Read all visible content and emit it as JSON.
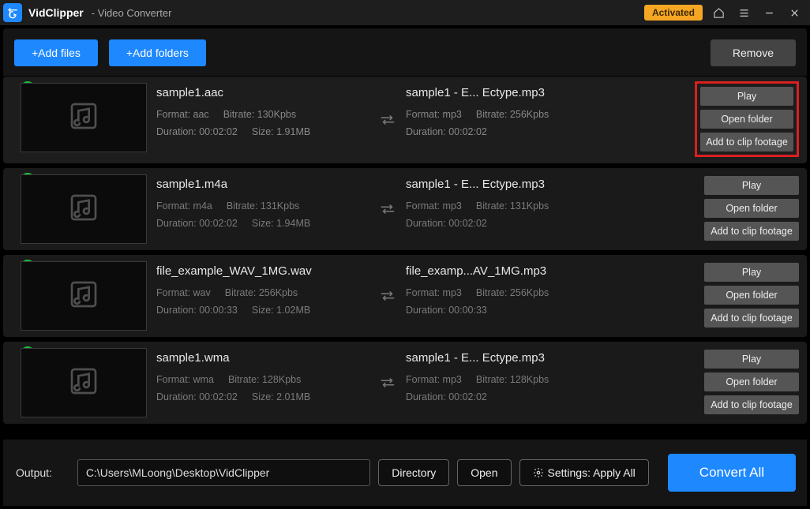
{
  "titlebar": {
    "app_name": "VidClipper",
    "subtitle": "- Video Converter",
    "activated": "Activated"
  },
  "toolbar": {
    "add_files": "+Add files",
    "add_folders": "+Add folders",
    "remove": "Remove"
  },
  "items": [
    {
      "highlight": true,
      "boxed": true,
      "src": {
        "name": "sample1.aac",
        "format": "Format: aac",
        "bitrate": "Bitrate: 130Kpbs",
        "duration": "Duration: 00:02:02",
        "size": "Size: 1.91MB"
      },
      "dst": {
        "name": "sample1 - E... Ectype.mp3",
        "format": "Format: mp3",
        "bitrate": "Bitrate: 256Kpbs",
        "duration": "Duration: 00:02:02"
      }
    },
    {
      "highlight": false,
      "boxed": false,
      "src": {
        "name": "sample1.m4a",
        "format": "Format: m4a",
        "bitrate": "Bitrate: 131Kpbs",
        "duration": "Duration: 00:02:02",
        "size": "Size: 1.94MB"
      },
      "dst": {
        "name": "sample1 - E... Ectype.mp3",
        "format": "Format: mp3",
        "bitrate": "Bitrate: 131Kpbs",
        "duration": "Duration: 00:02:02"
      }
    },
    {
      "highlight": false,
      "boxed": false,
      "src": {
        "name": "file_example_WAV_1MG.wav",
        "format": "Format: wav",
        "bitrate": "Bitrate: 256Kpbs",
        "duration": "Duration: 00:00:33",
        "size": "Size: 1.02MB"
      },
      "dst": {
        "name": "file_examp...AV_1MG.mp3",
        "format": "Format: mp3",
        "bitrate": "Bitrate: 256Kpbs",
        "duration": "Duration: 00:00:33"
      }
    },
    {
      "highlight": false,
      "boxed": false,
      "src": {
        "name": "sample1.wma",
        "format": "Format: wma",
        "bitrate": "Bitrate: 128Kpbs",
        "duration": "Duration: 00:02:02",
        "size": "Size: 2.01MB"
      },
      "dst": {
        "name": "sample1 - E... Ectype.mp3",
        "format": "Format: mp3",
        "bitrate": "Bitrate: 128Kpbs",
        "duration": "Duration: 00:02:02"
      }
    }
  ],
  "item_actions": {
    "play": "Play",
    "open_folder": "Open folder",
    "add_to_clip": "Add to clip footage"
  },
  "footer": {
    "output_label": "Output:",
    "path": "C:\\Users\\MLoong\\Desktop\\VidClipper",
    "directory": "Directory",
    "open": "Open",
    "settings": "Settings: Apply All",
    "convert_all": "Convert All"
  }
}
